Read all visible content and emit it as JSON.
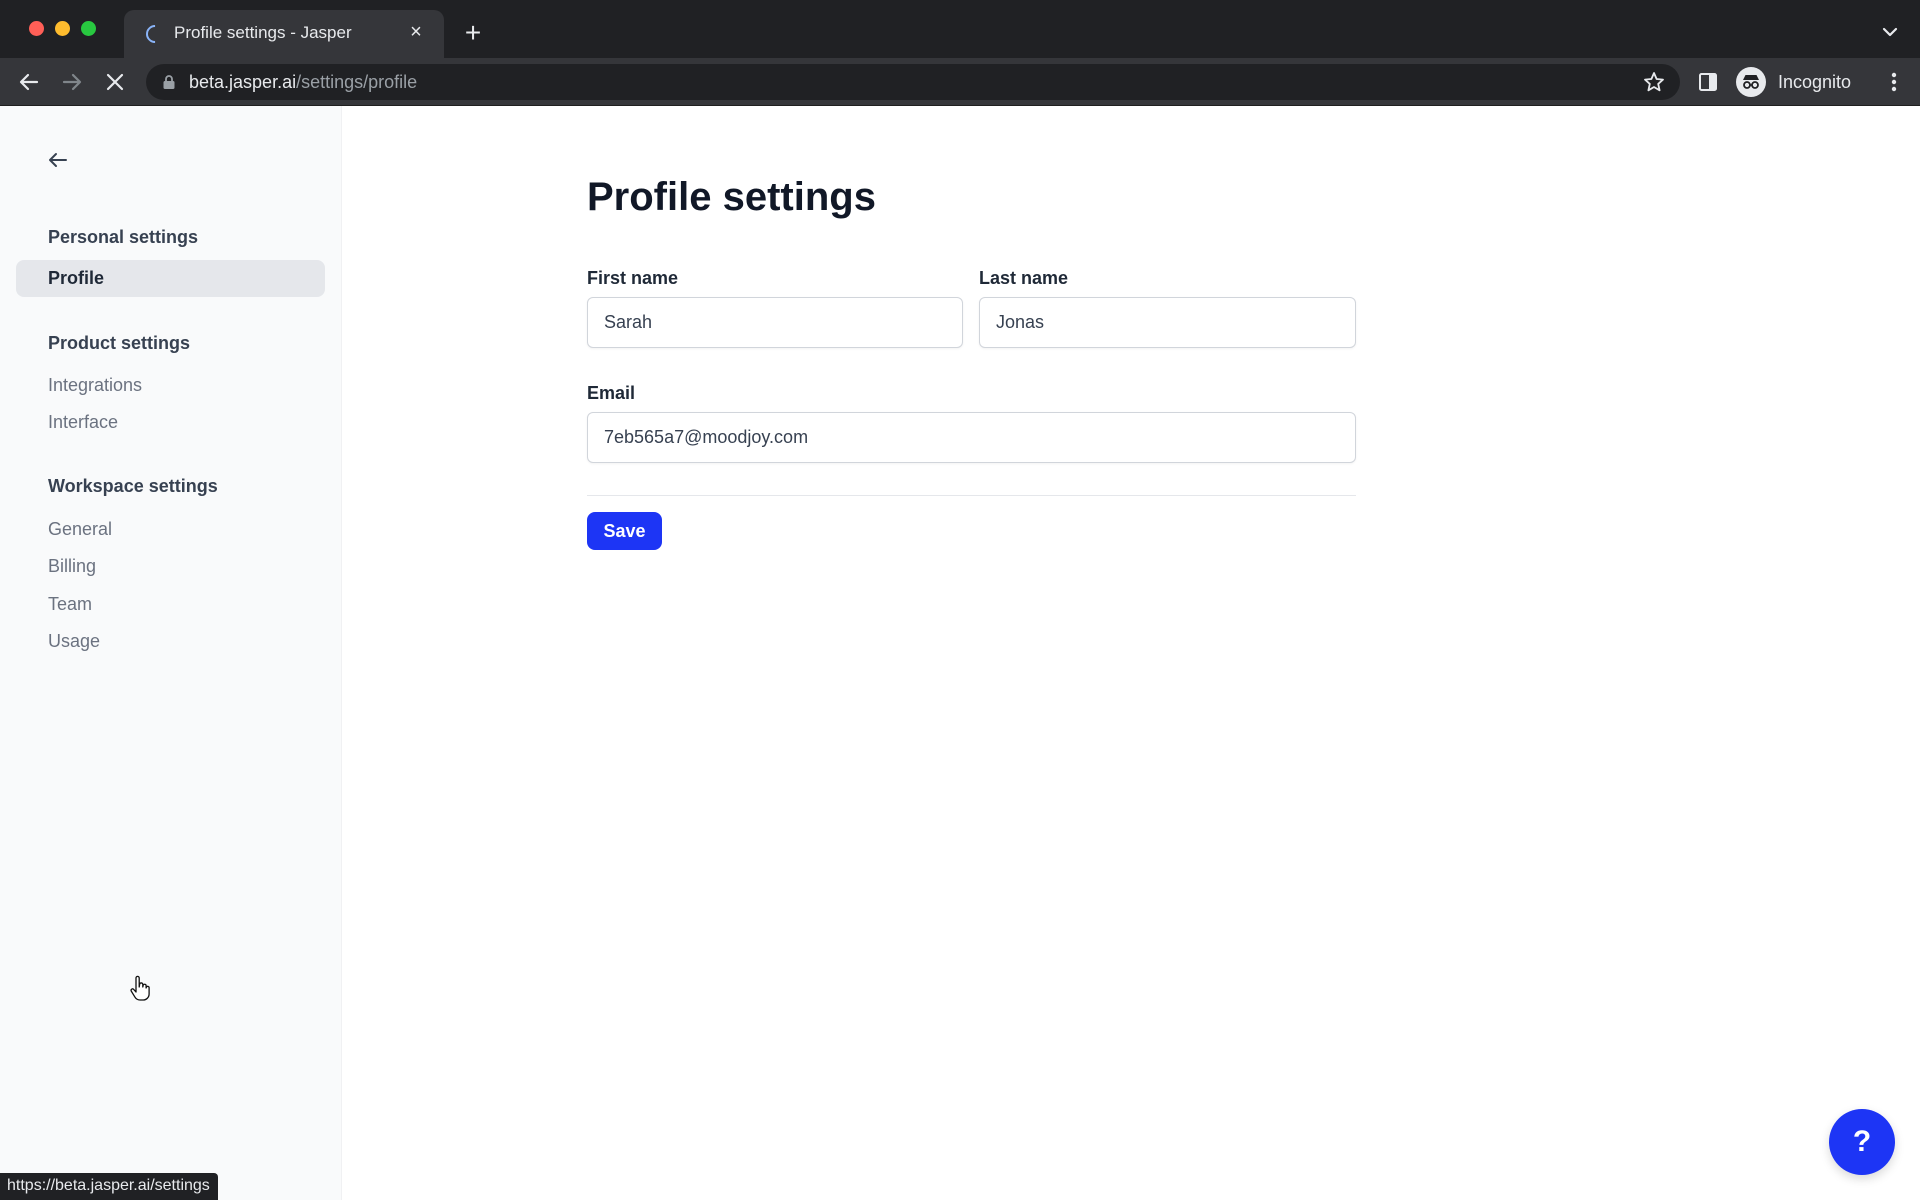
{
  "browser": {
    "tab_title": "Profile settings - Jasper",
    "tab_close": "×",
    "new_tab": "+",
    "url_host": "beta.jasper.ai",
    "url_path": "/settings/profile",
    "profile_label": "Incognito",
    "status_url": "https://beta.jasper.ai/settings"
  },
  "sidebar": {
    "sections": [
      {
        "heading": "Personal settings",
        "items": [
          "Profile"
        ]
      },
      {
        "heading": "Product settings",
        "items": [
          "Integrations",
          "Interface"
        ]
      },
      {
        "heading": "Workspace settings",
        "items": [
          "General",
          "Billing",
          "Team",
          "Usage"
        ]
      }
    ],
    "active_item": "Profile"
  },
  "main": {
    "title": "Profile settings",
    "first_name": {
      "label": "First name",
      "value": "Sarah"
    },
    "last_name": {
      "label": "Last name",
      "value": "Jonas"
    },
    "email": {
      "label": "Email",
      "value": "7eb565a7@moodjoy.com"
    },
    "save_label": "Save"
  },
  "help": {
    "label": "?"
  },
  "colors": {
    "accent": "#1d35f5",
    "sidebar_bg": "#f9fafb",
    "chrome_dark": "#202124"
  }
}
